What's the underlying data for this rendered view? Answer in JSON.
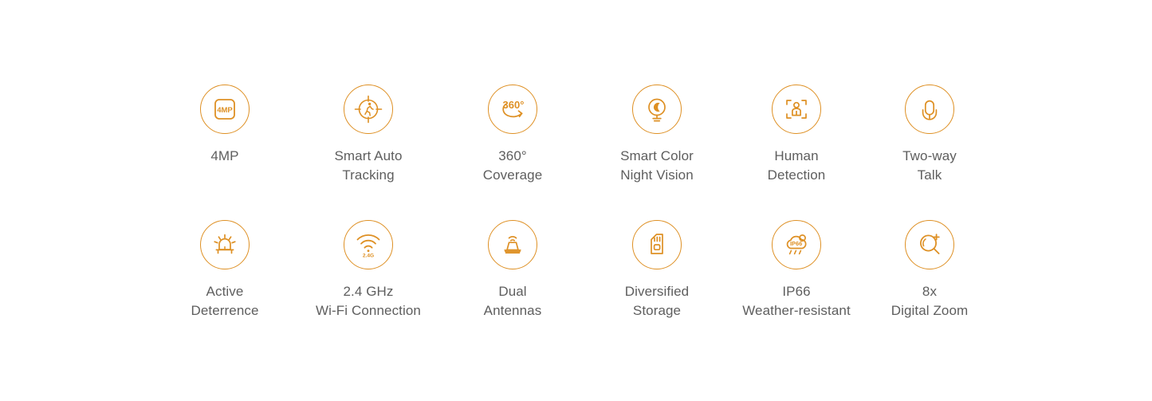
{
  "theme": {
    "accent_color": "#de9024",
    "label_color": "#5e5e5e",
    "background_color": "#ffffff"
  },
  "features": [
    {
      "id": "4mp",
      "icon": "4mp-sensor-icon",
      "label": "4MP",
      "row": 1,
      "col": 1
    },
    {
      "id": "smart-auto-tracking",
      "icon": "motion-tracking-target-icon",
      "label": "Smart Auto\nTracking",
      "row": 1,
      "col": 2
    },
    {
      "id": "360-coverage",
      "icon": "360-degree-rotation-icon",
      "label": "360°\nCoverage",
      "row": 1,
      "col": 3
    },
    {
      "id": "smart-color-night-vision",
      "icon": "moon-spotlight-icon",
      "label": "Smart Color\nNight Vision",
      "row": 1,
      "col": 4
    },
    {
      "id": "human-detection",
      "icon": "person-in-frame-icon",
      "label": "Human\nDetection",
      "row": 1,
      "col": 5
    },
    {
      "id": "two-way-talk",
      "icon": "microphone-icon",
      "label": "Two-way\nTalk",
      "row": 1,
      "col": 6
    },
    {
      "id": "active-deterrence",
      "icon": "siren-light-icon",
      "label": "Active\nDeterrence",
      "row": 2,
      "col": 1
    },
    {
      "id": "wifi-connection",
      "icon": "wifi-signal-icon",
      "label": "2.4 GHz\nWi-Fi Connection",
      "row": 2,
      "col": 2
    },
    {
      "id": "dual-antennas",
      "icon": "dual-antenna-icon",
      "label": "Dual\nAntennas",
      "row": 2,
      "col": 3
    },
    {
      "id": "diversified-storage",
      "icon": "sd-card-icon",
      "label": "Diversified\nStorage",
      "row": 2,
      "col": 4
    },
    {
      "id": "ip66-weather-resistant",
      "icon": "rain-cloud-ip66-icon",
      "label": "IP66\nWeather-resistant",
      "row": 2,
      "col": 5
    },
    {
      "id": "8x-digital-zoom",
      "icon": "magnifier-plus-icon",
      "label": "8x\nDigital Zoom",
      "row": 2,
      "col": 6
    }
  ],
  "icon_text": {
    "mp_badge": "4MP",
    "degree_badge": "360°",
    "wifi_badge": "2.4G",
    "ip_badge": "IP66"
  }
}
